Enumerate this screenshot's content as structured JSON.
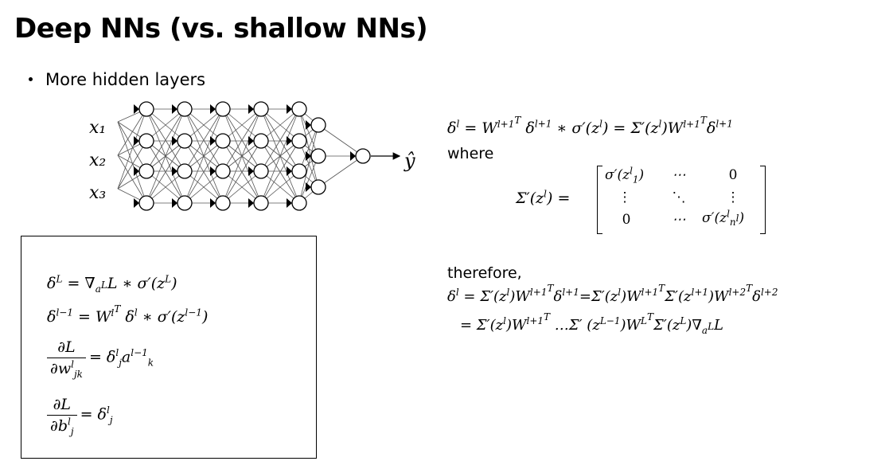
{
  "slide": {
    "title": "Deep NNs (vs. shallow NNs)",
    "bullet": "More hidden layers"
  },
  "network": {
    "inputs": [
      "x₁",
      "x₂",
      "x₃"
    ],
    "output": "ŷ",
    "hidden_layers_4_nodes": 5,
    "layer_3_nodes": 3,
    "layer_1_nodes": 1
  },
  "box_equations": {
    "delta_L_lhs": "δ",
    "delta_L_text": "= ∇",
    "eq1": "δ^L = ∇_{a^L} L * σ′(z^L)",
    "eq2": "δ^{l−1} = W^{l^T} δ^l * σ′(z^{l−1})",
    "eq3": "∂L / ∂w^l_{jk} = δ^l_j a^{l−1}_k",
    "eq4": "∂L / ∂b^l_j = δ^l_j"
  },
  "right": {
    "eq_main": "δ^l = W^{l+1^T} δ^{l+1} * σ′(z^l) = Σ′(z^l)W^{l+1^T} δ^{l+1}",
    "where": "where",
    "sigma_def": "Σ′(z^l) =",
    "matrix": [
      [
        "σ′(z^l_1)",
        "⋯",
        "0"
      ],
      [
        "⋮",
        "⋱",
        "⋮"
      ],
      [
        "0",
        "⋯",
        "σ′(z^l_{n^l})"
      ]
    ],
    "therefore": "therefore,",
    "eq_t1": "δ^l = Σ′(z^l)W^{l+1^T}δ^{l+1}=Σ′(z^l)W^{l+1^T}Σ′(z^{l+1})W^{l+2^T}δ^{l+2}",
    "eq_t2": "= Σ′(z^l)W^{l+1^T} …Σ′ (z^{L−1})W^{L^T}Σ′(z^L)∇_{a^L}L"
  }
}
